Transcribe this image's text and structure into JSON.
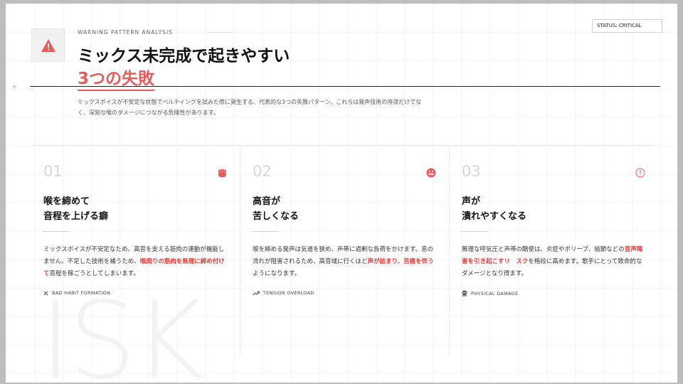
{
  "header": {
    "kicker": "WARNING PATTERN ANALYSIS",
    "status": "STATUS: CRITICAL",
    "title_line1": "ミックス未完成で起きやすい",
    "title_line2": "3つの失敗",
    "intro": "ミックスボイスが不安定な状態でベルティングを試みた際に発生する、代表的な3つの失敗パターン。これらは発声技術の停滞だけでなく、深刻な喉のダメージにつながる危険性があります。"
  },
  "watermark": "ISK",
  "cards": [
    {
      "num": "01",
      "icon": "fist-icon",
      "title1": "喉を締めて",
      "title2": "音程を上げる癖",
      "body_pre": "ミックスボイスが不安定なため、高音を支える筋肉の連動が機能しません。不足した技術を補うため、",
      "body_hl": "喉周りの筋肉を無理に締め付けて",
      "body_post": "音程を稼ごうとしてしまいます。",
      "tag": "BAD HABIT FORMATION",
      "tag_icon": "x-icon"
    },
    {
      "num": "02",
      "icon": "grimace-face-icon",
      "title1": "高音が",
      "title2": "苦しくなる",
      "body_pre": "喉を締める発声は気道を狭め、声帯に過剰な負荷をかけます。息の流れが阻害されるため、高音域に行くほど",
      "body_hl": "声が詰まり、苦痛を伴う",
      "body_post": "ようになります。",
      "tag": "TENSION OVERLOAD",
      "tag_icon": "trend-up-icon"
    },
    {
      "num": "03",
      "icon": "alert-circle-icon",
      "title1": "声が",
      "title2": "潰れやすくなる",
      "body_pre": "無理な呼気圧と声帯の酷使は、炎症やポリープ、結節などの",
      "body_hl": "音声障害を引き起こすリ　スク",
      "body_post": "を格段に高めます。歌手にとって致命的なダメージとなり得ます。",
      "tag": "PHYSICAL DAMAGE",
      "tag_icon": "skull-icon"
    }
  ],
  "colors": {
    "accent": "#e45d5d",
    "highlight": "#e53935"
  }
}
